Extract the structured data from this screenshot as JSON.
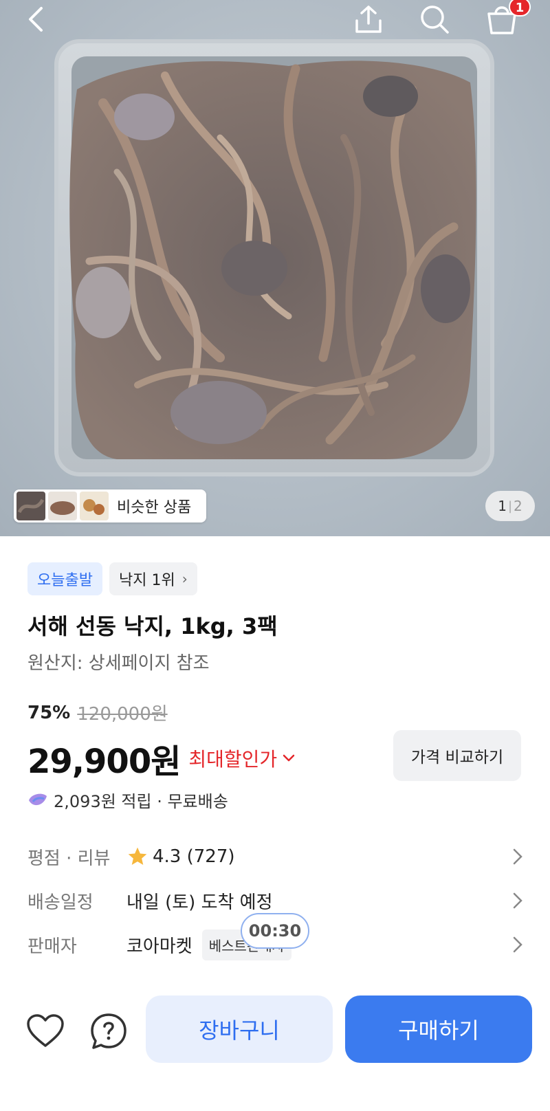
{
  "topbar": {
    "back_icon": "chevron-left-icon",
    "share_icon": "share-upload-icon",
    "search_icon": "search-icon",
    "cart_icon": "shopping-bag-icon",
    "cart_badge": "1",
    "badge_color": "#e5262b"
  },
  "gallery": {
    "similar_label": "비슷한 상품",
    "current": "1",
    "separator": "|",
    "total": "2"
  },
  "product": {
    "chips": [
      {
        "label": "오늘출발"
      },
      {
        "label": "낙지 1위"
      }
    ],
    "title": "서해 선동 낙지, 1kg, 3팩",
    "origin": "원산지: 상세페이지 참조",
    "discount_rate": "75%",
    "original_price": "120,000원",
    "price": "29,900원",
    "max_discount_label": "최대할인가",
    "compare_label": "가격 비교하기",
    "points": "2,093원 적립 · 무료배송"
  },
  "info": {
    "rating_key": "평점 · 리뷰",
    "rating_value": "4.3 (727)",
    "delivery_key": "배송일정",
    "delivery_value": "내일 (토) 도착 예정",
    "seller_key": "판매자",
    "seller_value": "코아마켓",
    "seller_badge": "베스트판매자",
    "timer": "00:30"
  },
  "actions": {
    "wishlist_icon": "heart-icon",
    "inquiry_icon": "question-icon",
    "cart_label": "장바구니",
    "buy_label": "구매하기",
    "accent_color": "#3b7bef",
    "sale_color": "#e4262a"
  }
}
